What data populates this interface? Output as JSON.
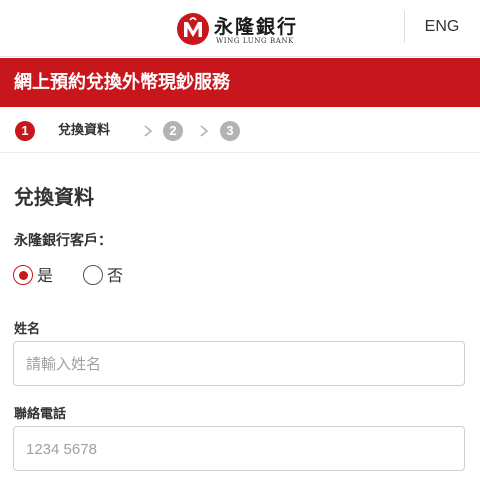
{
  "header": {
    "logo_cn": "永隆銀行",
    "logo_en": "WING LUNG BANK",
    "lang_button": "ENG"
  },
  "banner": {
    "title": "網上預約兌換外幣現鈔服務"
  },
  "steps": [
    {
      "number": "1",
      "label": "兌換資料",
      "state": "active"
    },
    {
      "number": "2",
      "label": "",
      "state": "inactive"
    },
    {
      "number": "3",
      "label": "",
      "state": "inactive"
    }
  ],
  "form": {
    "section_title": "兌換資料",
    "customer_question": "永隆銀行客戶：",
    "customer_options": [
      {
        "label": "是",
        "selected": true
      },
      {
        "label": "否",
        "selected": false
      }
    ],
    "name": {
      "label": "姓名",
      "placeholder": "請輸入姓名",
      "value": ""
    },
    "phone": {
      "label": "聯絡電話",
      "placeholder": "1234 5678",
      "value": ""
    }
  },
  "colors": {
    "brand_red": "#c8161d",
    "inactive_step": "#b3b3b3"
  },
  "icons": {
    "logo": "wing-lung-logo-icon",
    "chevron": "chevron-right-icon"
  }
}
